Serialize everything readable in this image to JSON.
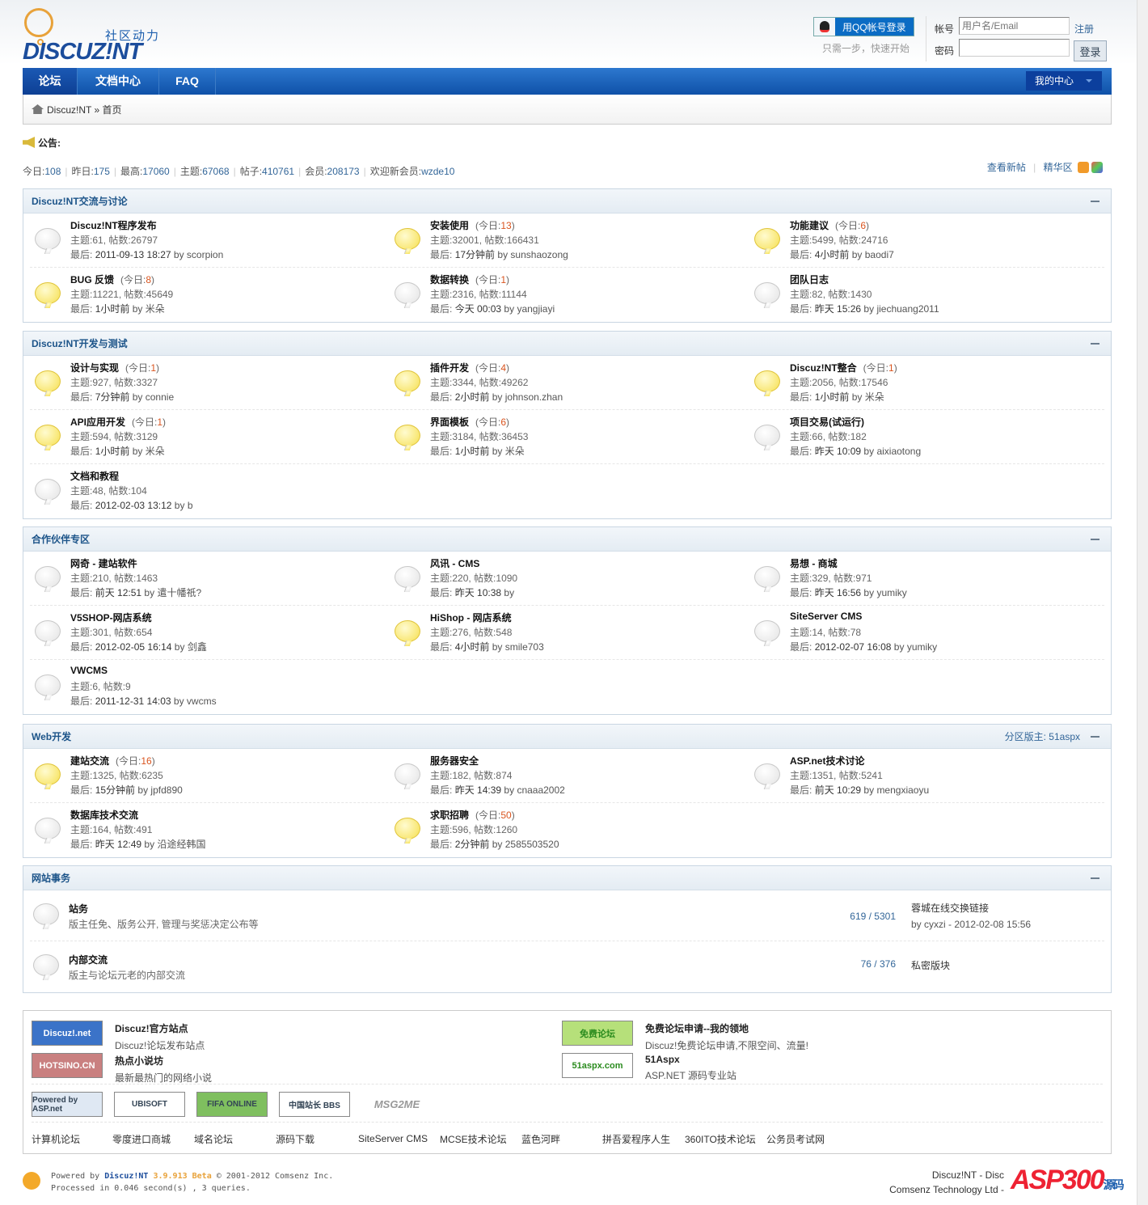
{
  "header": {
    "logo_sub": "社区动力",
    "logo_main": "DISCUZ!NT",
    "qq_login": "用QQ帐号登录",
    "qq_sub": "只需一步，快速开始",
    "account_label": "帐号",
    "account_placeholder": "用户名/Email",
    "password_label": "密码",
    "register": "注册",
    "login": "登录"
  },
  "nav": {
    "items": [
      "论坛",
      "文档中心",
      "FAQ"
    ],
    "my_center": "我的中心"
  },
  "breadcrumb": {
    "root": "Discuz!NT",
    "sep": "»",
    "current": "首页"
  },
  "notice": "公告:",
  "stats": [
    {
      "label": "今日:",
      "value": "108"
    },
    {
      "label": "昨日:",
      "value": "175"
    },
    {
      "label": "最高:",
      "value": "17060"
    },
    {
      "label": "主题:",
      "value": "67068"
    },
    {
      "label": "帖子:",
      "value": "410761"
    },
    {
      "label": "会员:",
      "value": "208173"
    },
    {
      "label": "欢迎新会员:",
      "value": "wzde10"
    }
  ],
  "top_links": {
    "new_posts": "查看新帖",
    "digest": "精华区"
  },
  "labels": {
    "topics": "主题:",
    "posts": "帖数:",
    "last": "最后:",
    "today": "今日:",
    "by": "by",
    "moderator": "分区版主:"
  },
  "sections": [
    {
      "title": "Discuz!NT交流与讨论",
      "forums": [
        {
          "name": "Discuz!NT程序发布",
          "topics": "61",
          "posts": "26797",
          "last": "2011-09-13 18:27",
          "by": "scorpion",
          "new": false
        },
        {
          "name": "安装使用",
          "today": "13",
          "topics": "32001",
          "posts": "166431",
          "last": "17分钟前",
          "by": "sunshaozong",
          "new": true
        },
        {
          "name": "功能建议",
          "today": "6",
          "topics": "5499",
          "posts": "24716",
          "last": "4小时前",
          "by": "baodi7",
          "new": true
        },
        {
          "name": "BUG 反馈",
          "today": "8",
          "topics": "11221",
          "posts": "45649",
          "last": "1小时前",
          "by": "米朵",
          "new": true
        },
        {
          "name": "数据转换",
          "today": "1",
          "topics": "2316",
          "posts": "11144",
          "last": "今天 00:03",
          "by": "yangjiayi",
          "new": false
        },
        {
          "name": "团队日志",
          "topics": "82",
          "posts": "1430",
          "last": "昨天 15:26",
          "by": "jiechuang2011",
          "new": false
        }
      ]
    },
    {
      "title": "Discuz!NT开发与测试",
      "forums": [
        {
          "name": "设计与实现",
          "today": "1",
          "topics": "927",
          "posts": "3327",
          "last": "7分钟前",
          "by": "connie",
          "new": true
        },
        {
          "name": "插件开发",
          "today": "4",
          "topics": "3344",
          "posts": "49262",
          "last": "2小时前",
          "by": "johnson.zhan",
          "new": true
        },
        {
          "name": "Discuz!NT整合",
          "today": "1",
          "topics": "2056",
          "posts": "17546",
          "last": "1小时前",
          "by": "米朵",
          "new": true
        },
        {
          "name": "API应用开发",
          "today": "1",
          "topics": "594",
          "posts": "3129",
          "last": "1小时前",
          "by": "米朵",
          "new": true
        },
        {
          "name": "界面模板",
          "today": "6",
          "topics": "3184",
          "posts": "36453",
          "last": "1小时前",
          "by": "米朵",
          "new": true
        },
        {
          "name": "项目交易(试运行)",
          "topics": "66",
          "posts": "182",
          "last": "昨天 10:09",
          "by": "aixiaotong",
          "new": false
        },
        {
          "name": "文档和教程",
          "topics": "48",
          "posts": "104",
          "last": "2012-02-03 13:12",
          "by": "b",
          "new": false
        }
      ]
    },
    {
      "title": "合作伙伴专区",
      "forums": [
        {
          "name": "网奇 - 建站软件",
          "topics": "210",
          "posts": "1463",
          "last": "前天 12:51",
          "by": "遣十幡祇?",
          "new": false
        },
        {
          "name": "风讯 - CMS",
          "topics": "220",
          "posts": "1090",
          "last": "昨天 10:38",
          "by": "",
          "new": false
        },
        {
          "name": "易想 - 商城",
          "topics": "329",
          "posts": "971",
          "last": "昨天 16:56",
          "by": "yumiky",
          "new": false
        },
        {
          "name": "V5SHOP-网店系统",
          "topics": "301",
          "posts": "654",
          "last": "2012-02-05 16:14",
          "by": "剑鑫",
          "new": false
        },
        {
          "name": "HiShop - 网店系统",
          "topics": "276",
          "posts": "548",
          "last": "4小时前",
          "by": "smile703",
          "new": true
        },
        {
          "name": "SiteServer CMS",
          "topics": "14",
          "posts": "78",
          "last": "2012-02-07 16:08",
          "by": "yumiky",
          "new": false
        },
        {
          "name": "VWCMS",
          "topics": "6",
          "posts": "9",
          "last": "2011-12-31 14:03",
          "by": "vwcms",
          "new": false
        }
      ]
    },
    {
      "title": "Web开发",
      "moderator": "51aspx",
      "forums": [
        {
          "name": "建站交流",
          "today": "16",
          "topics": "1325",
          "posts": "6235",
          "last": "15分钟前",
          "by": "jpfd890",
          "new": true
        },
        {
          "name": "服务器安全",
          "topics": "182",
          "posts": "874",
          "last": "昨天 14:39",
          "by": "cnaaa2002",
          "new": false
        },
        {
          "name": "ASP.net技术讨论",
          "topics": "1351",
          "posts": "5241",
          "last": "前天 10:29",
          "by": "mengxiaoyu",
          "new": false
        },
        {
          "name": "数据库技术交流",
          "topics": "164",
          "posts": "491",
          "last": "昨天 12:49",
          "by": "沿途经韩国",
          "new": false
        },
        {
          "name": "求职招聘",
          "today": "50",
          "topics": "596",
          "posts": "1260",
          "last": "2分钟前",
          "by": "2585503520",
          "new": true
        }
      ]
    }
  ],
  "list_section": {
    "title": "网站事务",
    "forums": [
      {
        "name": "站务",
        "desc": "版主任免、版务公开, 管理与奖惩决定公布等",
        "counts": "619 / 5301",
        "last_title": "蓉城在线交换链接",
        "last_info": "by cyxzi - 2012-02-08 15:56"
      },
      {
        "name": "内部交流",
        "desc": "版主与论坛元老的内部交流",
        "counts": "76 / 376",
        "last_title": "私密版块"
      }
    ]
  },
  "friend_links": {
    "featured": [
      {
        "logo": "Discuz!.net",
        "name": "Discuz!官方站点",
        "desc": "Discuz!论坛发布站点"
      },
      {
        "logo": "免费论坛",
        "name": "免费论坛申请--我的领地",
        "desc": "Discuz!免费论坛申请,不限空间、流量!"
      },
      {
        "logo": "HOTSINO.CN",
        "name": "热点小说坊",
        "desc": "最新最热门的网络小说"
      },
      {
        "logo": "51aspx.com",
        "name": "51Aspx",
        "desc": "ASP.NET 源码专业站"
      }
    ],
    "logos": [
      "Powered by ASP.net",
      "UBISOFT",
      "FIFA ONLINE",
      "中国站长 BBS",
      "MSG2ME"
    ],
    "text": [
      "计算机论坛",
      "零度进口商城",
      "域名论坛",
      "源码下载",
      "SiteServer CMS",
      "MCSE技术论坛",
      "蓝色河畔",
      "拼吾爱程序人生",
      "360ITO技术论坛",
      "公务员考试网"
    ]
  },
  "footer": {
    "powered_by": "Powered by",
    "product": "Discuz!NT",
    "version": "3.9.913 Beta",
    "copyright": "© 2001-2012 Comsenz Inc.",
    "processed": "Processed in 0.046 second(s) , 3 queries.",
    "right1": "Discuz!NT - Disc",
    "right2": "Comsenz Technology Ltd -",
    "watermark": "ASP300",
    "watermark_sub": "源码"
  }
}
